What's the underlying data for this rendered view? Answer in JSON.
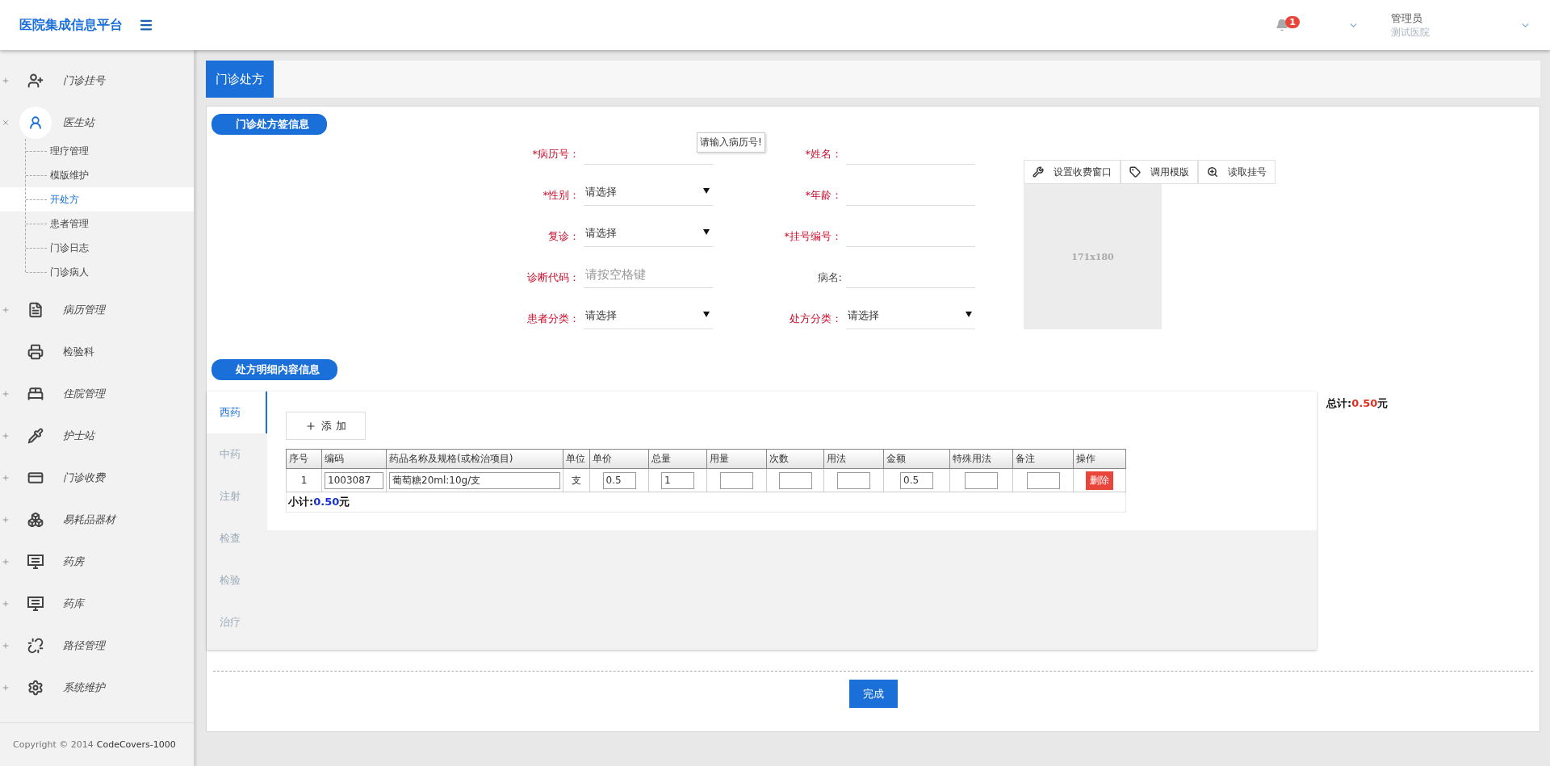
{
  "header": {
    "title": "医院集成信息平台",
    "notifications": "1",
    "user": {
      "name": "管理员",
      "hospital": "测试医院"
    }
  },
  "sidebar": {
    "items": [
      {
        "label": "门诊挂号",
        "kind": "group",
        "expanded": false
      },
      {
        "label": "医生站",
        "kind": "group",
        "expanded": true,
        "children": [
          {
            "label": "理疗管理",
            "selected": false
          },
          {
            "label": "模版维护",
            "selected": false
          },
          {
            "label": "开处方",
            "selected": true
          },
          {
            "label": "患者管理",
            "selected": false
          },
          {
            "label": "门诊日志",
            "selected": false
          },
          {
            "label": "门诊病人",
            "selected": false
          }
        ]
      },
      {
        "label": "病历管理",
        "kind": "group",
        "expanded": false
      },
      {
        "label": "检验科",
        "kind": "link"
      },
      {
        "label": "住院管理",
        "kind": "group",
        "expanded": false
      },
      {
        "label": "护士站",
        "kind": "group",
        "expanded": false
      },
      {
        "label": "门诊收费",
        "kind": "group",
        "expanded": false
      },
      {
        "label": "易耗品器材",
        "kind": "group",
        "expanded": false
      },
      {
        "label": "药房",
        "kind": "group",
        "expanded": false
      },
      {
        "label": "药库",
        "kind": "group",
        "expanded": false
      },
      {
        "label": "路径管理",
        "kind": "group",
        "expanded": false
      },
      {
        "label": "系统维护",
        "kind": "group",
        "expanded": false
      }
    ],
    "copyright": "Copyright © 2014",
    "brand": "CodeCovers-1000"
  },
  "page_tab": "门诊处方",
  "sign_section": {
    "title": "门诊处方签信息",
    "fields": [
      {
        "label": "*病历号：",
        "kind": "text",
        "emphasized": true,
        "tooltip": "请输入病历号!"
      },
      {
        "label": "*姓名：",
        "kind": "text",
        "emphasized": true
      },
      {
        "label": "*性别：",
        "kind": "select",
        "emphasized": true,
        "value": "请选择"
      },
      {
        "label": "*年龄：",
        "kind": "text",
        "emphasized": true
      },
      {
        "label": "复诊：",
        "kind": "select",
        "emphasized": true,
        "value": "请选择"
      },
      {
        "label": "*挂号编号：",
        "kind": "text",
        "emphasized": true
      },
      {
        "label": "诊断代码：",
        "kind": "text",
        "emphasized": true,
        "placeholder": "请按空格键"
      },
      {
        "label": "病名:",
        "kind": "text",
        "emphasized": false
      },
      {
        "label": "患者分类：",
        "kind": "select",
        "emphasized": true,
        "value": "请选择"
      },
      {
        "label": "处方分类：",
        "kind": "select",
        "emphasized": true,
        "value": "请选择"
      }
    ],
    "actions": [
      {
        "label": "设置收费窗口"
      },
      {
        "label": "调用模版"
      },
      {
        "label": "读取挂号"
      }
    ],
    "photo_placeholder": "171x180"
  },
  "detail_section": {
    "title": "处方明细内容信息",
    "tabs": [
      {
        "label": "西药",
        "selected": true
      },
      {
        "label": "中药",
        "selected": false
      },
      {
        "label": "注射",
        "selected": false
      },
      {
        "label": "检查",
        "selected": false
      },
      {
        "label": "检验",
        "selected": false
      },
      {
        "label": "治疗",
        "selected": false
      }
    ],
    "add_button": "添 加",
    "table": {
      "columns": [
        "序号",
        "编码",
        "药品名称及规格(或检治项目)",
        "单位",
        "单价",
        "总量",
        "用量",
        "次数",
        "用法",
        "金额",
        "特殊用法",
        "备注",
        "操作"
      ],
      "rows": [
        [
          {
            "kind": "text",
            "value": "1"
          },
          {
            "kind": "input",
            "value": "1003087"
          },
          {
            "kind": "input",
            "value": "葡萄糖20ml:10g/支"
          },
          {
            "kind": "text",
            "value": "支"
          },
          {
            "kind": "input",
            "value": "0.5"
          },
          {
            "kind": "input",
            "value": "1"
          },
          {
            "kind": "input"
          },
          {
            "kind": "input"
          },
          {
            "kind": "input"
          },
          {
            "kind": "input",
            "value": "0.5"
          },
          {
            "kind": "input"
          },
          {
            "kind": "input"
          },
          {
            "kind": "button",
            "value": "删除"
          }
        ]
      ]
    },
    "subtotal": {
      "label": "小计:",
      "amount": "0.50",
      "unit": "元"
    },
    "total": {
      "label": "总计:",
      "amount": "0.50",
      "unit": "元"
    }
  },
  "finish_button": "完成"
}
